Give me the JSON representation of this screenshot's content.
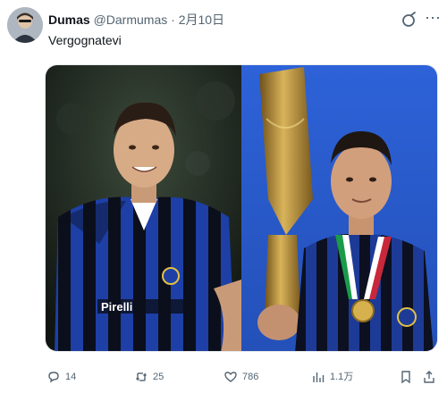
{
  "post": {
    "author_name": "Dumas",
    "author_handle": "@Darmumas",
    "separator": "·",
    "date": "2月10日",
    "text": "Vergognatevi"
  },
  "media": {
    "left_photo": "player-in-blue-black-striped-kit",
    "right_photo": "player-with-trophy-and-medal",
    "kit_text": "Pirelli"
  },
  "actions": {
    "replies": "14",
    "reposts": "25",
    "likes": "786",
    "views": "1.1万"
  },
  "icons": {
    "grok": "grok-icon",
    "more": "more-icon",
    "reply": "reply-icon",
    "repost": "repost-icon",
    "like": "heart-icon",
    "views": "views-chart-icon",
    "bookmark": "bookmark-icon",
    "share": "share-icon"
  },
  "colors": {
    "muted_text": "#536471",
    "primary_text": "#0f1419",
    "inter_blue": "#1a3f9e",
    "photo_right_bg": "#2f63d6"
  }
}
